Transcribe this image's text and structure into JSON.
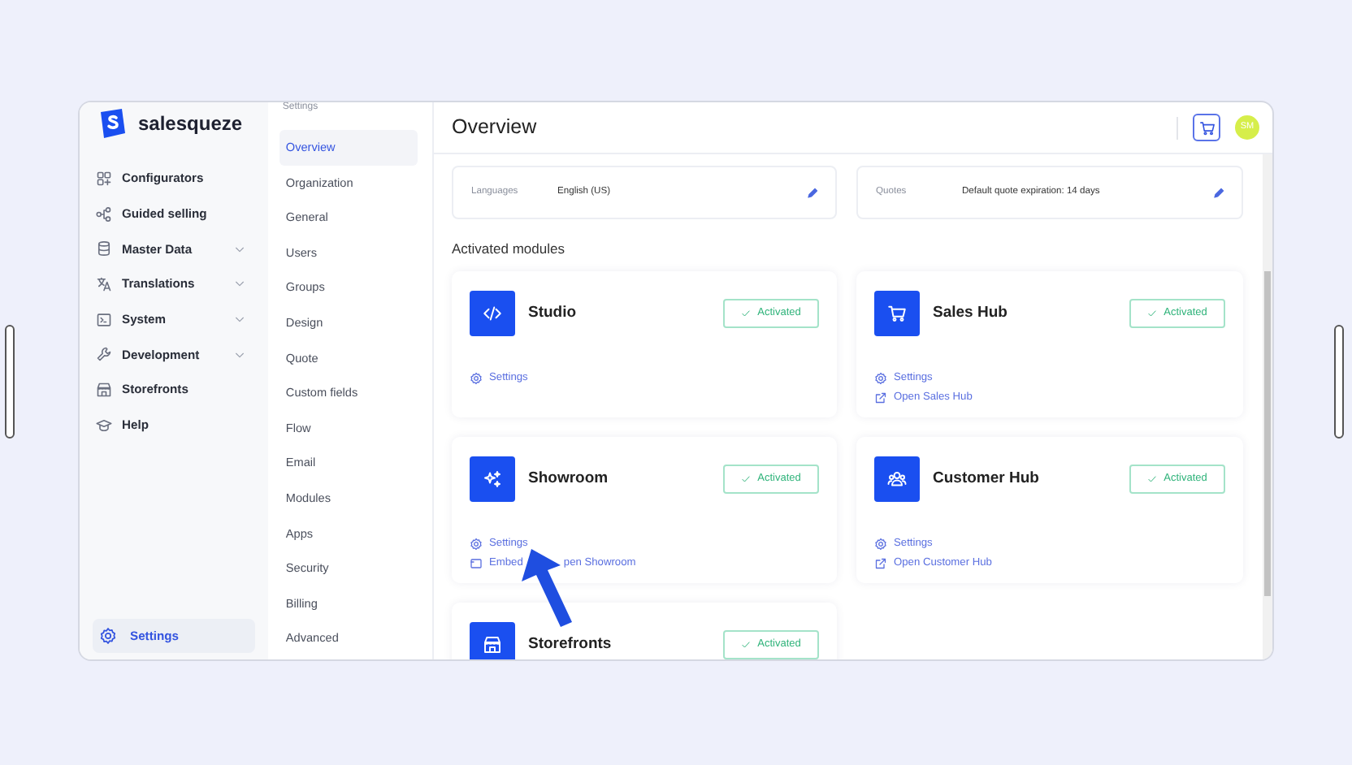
{
  "brand": "salesqueze",
  "sidebar": {
    "items": [
      {
        "label": "Configurators",
        "expandable": false,
        "selected": false
      },
      {
        "label": "Guided selling",
        "expandable": false,
        "selected": false
      },
      {
        "label": "Master Data",
        "expandable": true,
        "selected": false
      },
      {
        "label": "Translations",
        "expandable": true,
        "selected": false
      },
      {
        "label": "System",
        "expandable": true,
        "selected": false
      },
      {
        "label": "Development",
        "expandable": true,
        "selected": false
      },
      {
        "label": "Storefronts",
        "expandable": false,
        "selected": false
      },
      {
        "label": "Help",
        "expandable": false,
        "selected": false
      }
    ],
    "footer": {
      "label": "Settings",
      "selected": true
    }
  },
  "subnav": {
    "heading": "Settings",
    "items": [
      {
        "label": "Overview",
        "selected": true
      },
      {
        "label": "Organization",
        "selected": false
      },
      {
        "label": "General",
        "selected": false
      },
      {
        "label": "Users",
        "selected": false
      },
      {
        "label": "Groups",
        "selected": false
      },
      {
        "label": "Design",
        "selected": false
      },
      {
        "label": "Quote",
        "selected": false
      },
      {
        "label": "Custom fields",
        "selected": false
      },
      {
        "label": "Flow",
        "selected": false
      },
      {
        "label": "Email",
        "selected": false
      },
      {
        "label": "Modules",
        "selected": false
      },
      {
        "label": "Apps",
        "selected": false
      },
      {
        "label": "Security",
        "selected": false
      },
      {
        "label": "Billing",
        "selected": false
      },
      {
        "label": "Advanced",
        "selected": false
      }
    ]
  },
  "header": {
    "title": "Overview",
    "avatar": "SM"
  },
  "info_cards": [
    {
      "label": "Languages",
      "value": "English (US)"
    },
    {
      "label": "Quotes",
      "value": "Default quote expiration: 14 days"
    }
  ],
  "section_title": "Activated modules",
  "modules": [
    {
      "name": "Studio",
      "status": "Activated",
      "links": [
        {
          "kind": "settings",
          "text": "Settings"
        }
      ]
    },
    {
      "name": "Sales Hub",
      "status": "Activated",
      "links": [
        {
          "kind": "settings",
          "text": "Settings"
        },
        {
          "kind": "open",
          "text": "Open Sales Hub"
        }
      ]
    },
    {
      "name": "Showroom",
      "status": "Activated",
      "links": [
        {
          "kind": "settings",
          "text": "Settings"
        },
        {
          "kind": "embed",
          "text": "Embed",
          "text_after": "pen Showroom"
        }
      ]
    },
    {
      "name": "Customer Hub",
      "status": "Activated",
      "links": [
        {
          "kind": "settings",
          "text": "Settings"
        },
        {
          "kind": "open",
          "text": "Open Customer Hub"
        }
      ]
    },
    {
      "name": "Storefronts",
      "status": "Activated"
    }
  ]
}
